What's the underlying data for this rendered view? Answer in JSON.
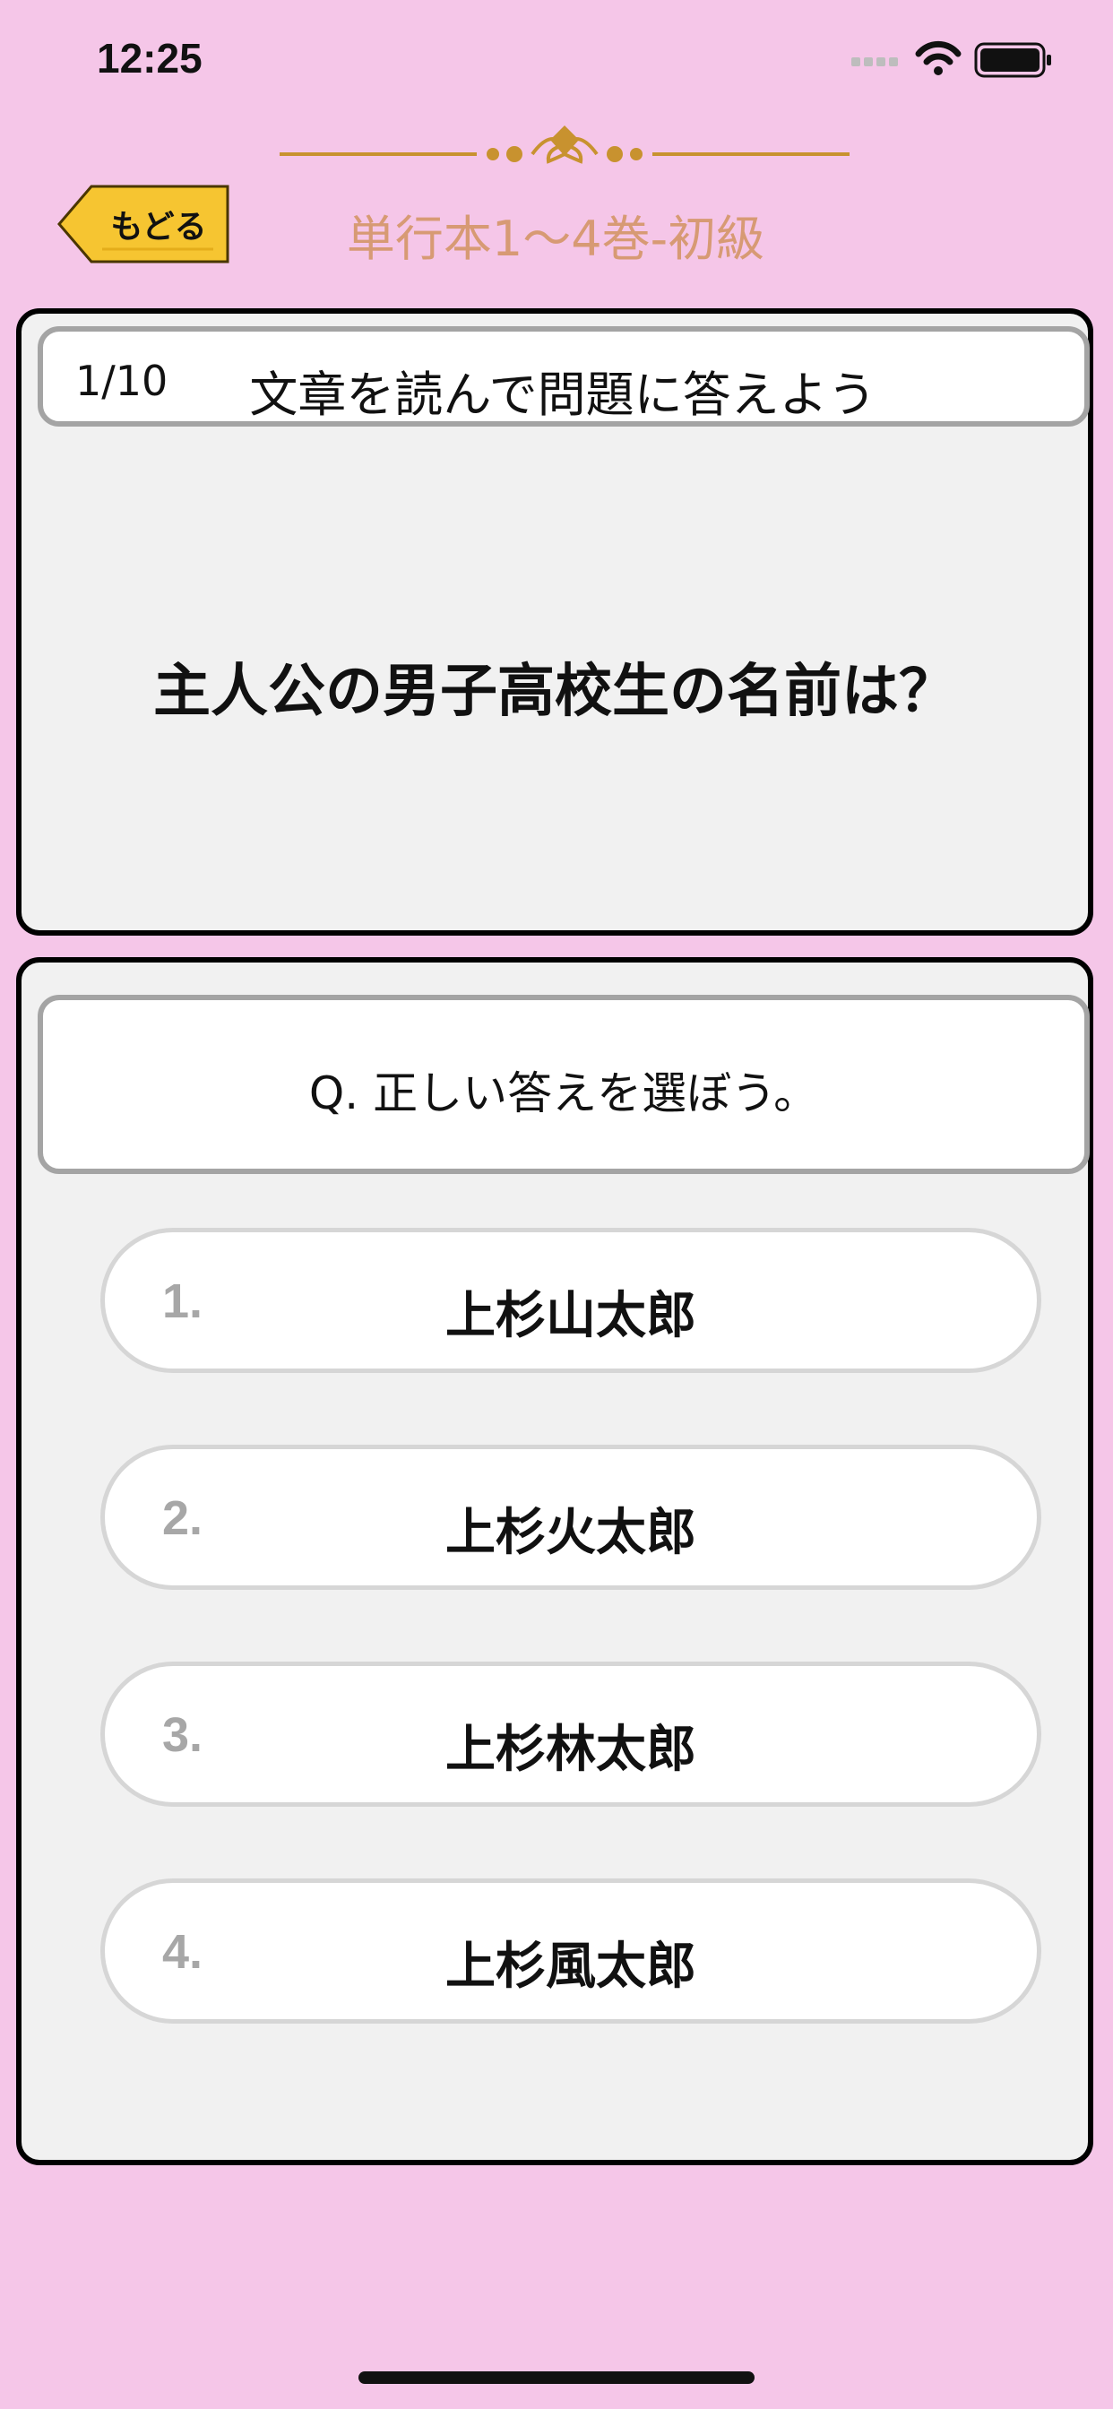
{
  "status_bar": {
    "time": "12:25",
    "icons": [
      "signal-icon",
      "wifi-icon",
      "battery-icon"
    ]
  },
  "header": {
    "back_label": "もどる",
    "title": "単行本1〜4巻-初級",
    "ornament_icon": "ornament-divider-icon",
    "back_icon": "back-arrow-tag-icon"
  },
  "question": {
    "progress": "1/10",
    "instruction": "文章を読んで問題に答えよう",
    "text": "主人公の男子高校生の名前は？"
  },
  "answers": {
    "prompt": "Q. 正しい答えを選ぼう。",
    "options": [
      {
        "number": "1.",
        "label": "上杉山太郎"
      },
      {
        "number": "2.",
        "label": "上杉火太郎"
      },
      {
        "number": "3.",
        "label": "上杉林太郎"
      },
      {
        "number": "4.",
        "label": "上杉風太郎"
      }
    ]
  },
  "colors": {
    "background": "#f5c6e8",
    "card": "#f1f1f1",
    "title": "#d79a74",
    "ornament": "#c8922f",
    "back_button": "#f6c531",
    "border_gray": "#a4a4a4"
  }
}
